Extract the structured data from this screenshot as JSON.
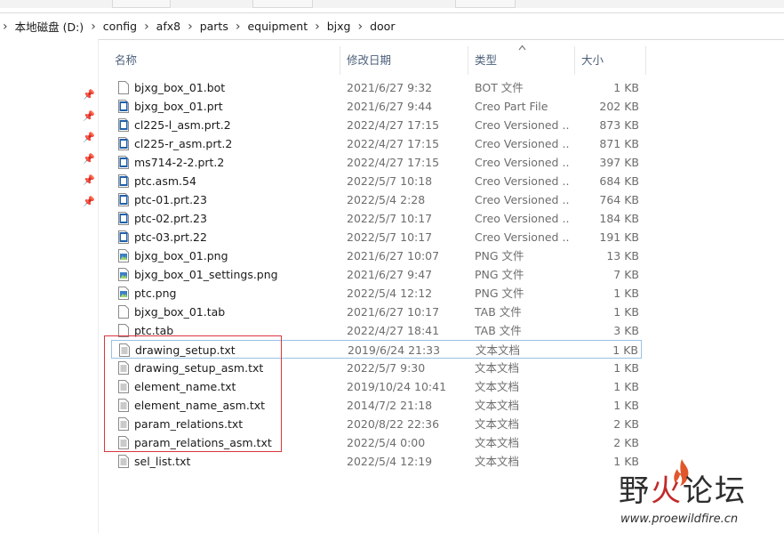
{
  "breadcrumb": [
    "本地磁盘 (D:)",
    "config",
    "afx8",
    "parts",
    "equipment",
    "bjxg",
    "door"
  ],
  "columns": {
    "name": "名称",
    "date": "修改日期",
    "type": "类型",
    "size": "大小"
  },
  "files": [
    {
      "name": "bjxg_box_01.bot",
      "date": "2021/6/27 9:32",
      "type": "BOT 文件",
      "size": "1 KB",
      "icon": "generic-file-icon"
    },
    {
      "name": "bjxg_box_01.prt",
      "date": "2021/6/27 9:44",
      "type": "Creo Part File",
      "size": "202 KB",
      "icon": "creo-file-icon"
    },
    {
      "name": "cl225-l_asm.prt.2",
      "date": "2022/4/27 17:15",
      "type": "Creo Versioned ...",
      "size": "873 KB",
      "icon": "creo-file-icon"
    },
    {
      "name": "cl225-r_asm.prt.2",
      "date": "2022/4/27 17:15",
      "type": "Creo Versioned ...",
      "size": "871 KB",
      "icon": "creo-file-icon"
    },
    {
      "name": "ms714-2-2.prt.2",
      "date": "2022/4/27 17:15",
      "type": "Creo Versioned ...",
      "size": "397 KB",
      "icon": "creo-file-icon"
    },
    {
      "name": "ptc.asm.54",
      "date": "2022/5/7 10:18",
      "type": "Creo Versioned ...",
      "size": "684 KB",
      "icon": "creo-file-icon"
    },
    {
      "name": "ptc-01.prt.23",
      "date": "2022/5/4 2:28",
      "type": "Creo Versioned ...",
      "size": "764 KB",
      "icon": "creo-file-icon"
    },
    {
      "name": "ptc-02.prt.23",
      "date": "2022/5/7 10:17",
      "type": "Creo Versioned ...",
      "size": "184 KB",
      "icon": "creo-file-icon"
    },
    {
      "name": "ptc-03.prt.22",
      "date": "2022/5/7 10:17",
      "type": "Creo Versioned ...",
      "size": "191 KB",
      "icon": "creo-file-icon"
    },
    {
      "name": "bjxg_box_01.png",
      "date": "2021/6/27 10:07",
      "type": "PNG 文件",
      "size": "13 KB",
      "icon": "png-file-icon"
    },
    {
      "name": "bjxg_box_01_settings.png",
      "date": "2021/6/27 9:47",
      "type": "PNG 文件",
      "size": "7 KB",
      "icon": "png-file-icon"
    },
    {
      "name": "ptc.png",
      "date": "2022/5/4 12:12",
      "type": "PNG 文件",
      "size": "1 KB",
      "icon": "png-file-icon"
    },
    {
      "name": "bjxg_box_01.tab",
      "date": "2021/6/27 10:17",
      "type": "TAB 文件",
      "size": "1 KB",
      "icon": "generic-file-icon"
    },
    {
      "name": "ptc.tab",
      "date": "2022/4/27 18:41",
      "type": "TAB 文件",
      "size": "3 KB",
      "icon": "generic-file-icon"
    },
    {
      "name": "drawing_setup.txt",
      "date": "2019/6/24 21:33",
      "type": "文本文档",
      "size": "1 KB",
      "icon": "text-file-icon",
      "focused": true
    },
    {
      "name": "drawing_setup_asm.txt",
      "date": "2022/5/7 9:30",
      "type": "文本文档",
      "size": "1 KB",
      "icon": "text-file-icon"
    },
    {
      "name": "element_name.txt",
      "date": "2019/10/24 10:41",
      "type": "文本文档",
      "size": "1 KB",
      "icon": "text-file-icon"
    },
    {
      "name": "element_name_asm.txt",
      "date": "2014/7/2 21:18",
      "type": "文本文档",
      "size": "1 KB",
      "icon": "text-file-icon"
    },
    {
      "name": "param_relations.txt",
      "date": "2020/8/22 22:36",
      "type": "文本文档",
      "size": "2 KB",
      "icon": "text-file-icon"
    },
    {
      "name": "param_relations_asm.txt",
      "date": "2022/5/4 0:00",
      "type": "文本文档",
      "size": "2 KB",
      "icon": "text-file-icon"
    },
    {
      "name": "sel_list.txt",
      "date": "2022/5/4 12:19",
      "type": "文本文档",
      "size": "1 KB",
      "icon": "text-file-icon"
    }
  ],
  "watermark": {
    "title_part1": "野",
    "title_part2": "火",
    "title_part3": "论坛",
    "url": "www.proewildfire.cn"
  },
  "colors": {
    "focus_border": "#99c2e6",
    "annotation_red": "#d9363e",
    "header_text": "#4c607a",
    "creo_icon_blue": "#1f5fa8"
  }
}
